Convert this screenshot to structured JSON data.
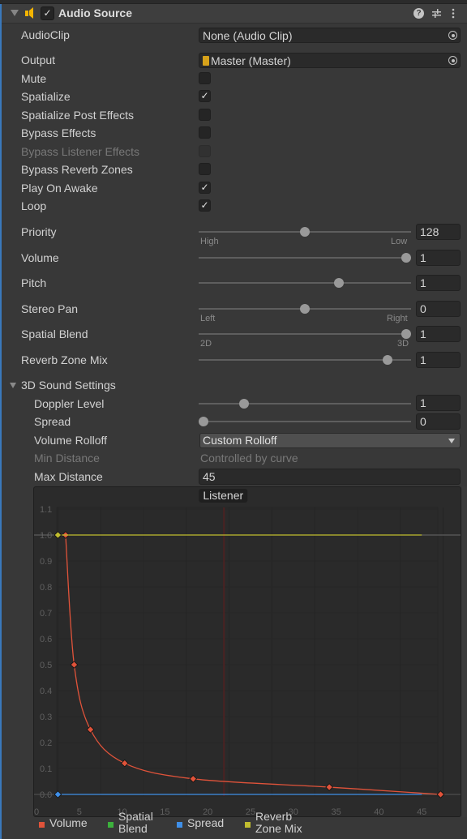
{
  "header": {
    "title": "Audio Source",
    "enabled": true,
    "icons": [
      "foldout-arrow-icon",
      "audio-source-speaker-icon",
      "help-icon",
      "presets-sliders-icon",
      "more-vertical-icon"
    ]
  },
  "fields": {
    "audio_clip": {
      "label": "AudioClip",
      "value": "None (Audio Clip)"
    },
    "output": {
      "label": "Output",
      "value": "Master (Master)"
    },
    "mute": {
      "label": "Mute",
      "checked": false
    },
    "spatialize": {
      "label": "Spatialize",
      "checked": true
    },
    "spatialize_post_effects": {
      "label": "Spatialize Post Effects",
      "checked": false
    },
    "bypass_effects": {
      "label": "Bypass Effects",
      "checked": false
    },
    "bypass_listener_effects": {
      "label": "Bypass Listener Effects",
      "checked": false,
      "disabled": true
    },
    "bypass_reverb_zones": {
      "label": "Bypass Reverb Zones",
      "checked": false
    },
    "play_on_awake": {
      "label": "Play On Awake",
      "checked": true
    },
    "loop": {
      "label": "Loop",
      "checked": true
    },
    "priority": {
      "label": "Priority",
      "value": "128",
      "min": 0,
      "max": 256,
      "fraction": 0.5,
      "min_label": "High",
      "max_label": "Low"
    },
    "volume": {
      "label": "Volume",
      "value": "1",
      "fraction": 1.0
    },
    "pitch": {
      "label": "Pitch",
      "value": "1",
      "fraction": 0.667
    },
    "stereo_pan": {
      "label": "Stereo Pan",
      "value": "0",
      "fraction": 0.5,
      "min_label": "Left",
      "max_label": "Right"
    },
    "spatial_blend": {
      "label": "Spatial Blend",
      "value": "1",
      "fraction": 1.0,
      "min_label": "2D",
      "max_label": "3D"
    },
    "reverb_zone_mix": {
      "label": "Reverb Zone Mix",
      "value": "1",
      "fraction": 0.909
    }
  },
  "sound3d": {
    "label": "3D Sound Settings",
    "doppler_level": {
      "label": "Doppler Level",
      "value": "1",
      "fraction": 0.2
    },
    "spread": {
      "label": "Spread",
      "value": "0",
      "fraction": 0.0
    },
    "volume_rolloff": {
      "label": "Volume Rolloff",
      "value": "Custom Rolloff"
    },
    "min_distance": {
      "label": "Min Distance",
      "value": "Controlled by curve",
      "disabled": true
    },
    "max_distance": {
      "label": "Max Distance",
      "value": "45"
    }
  },
  "chart_data": {
    "type": "line",
    "title": "",
    "annotation": "Listener",
    "listener_x": 21.9,
    "xlim": [
      0,
      48
    ],
    "ylim": [
      -0.05,
      1.12
    ],
    "x_ticks": [
      0,
      5,
      10,
      15,
      20,
      25,
      30,
      35,
      40,
      45
    ],
    "y_ticks": [
      0.0,
      0.1,
      0.2,
      0.3,
      0.4,
      0.5,
      0.6,
      0.7,
      0.8,
      0.9,
      1.0,
      1.1
    ],
    "y_tick_labels": [
      "0.0",
      "0.1",
      "0.2",
      "0.3",
      "0.4",
      "0.5",
      "0.6",
      "0.7",
      "0.8",
      "0.9",
      "1.0",
      "1.1"
    ],
    "grid": true,
    "legend_position": "bottom",
    "series": [
      {
        "name": "Volume",
        "color": "#e0533a",
        "keys": [
          [
            3.4,
            1.0
          ],
          [
            4.4,
            0.5
          ],
          [
            6.3,
            0.25
          ],
          [
            10.3,
            0.12
          ],
          [
            18.3,
            0.06
          ],
          [
            34.2,
            0.028
          ],
          [
            47.2,
            0.0
          ]
        ]
      },
      {
        "name": "Spatial Blend",
        "color": "#3cb13c",
        "keys": []
      },
      {
        "name": "Spread",
        "color": "#3f8fe8",
        "keys": [
          [
            2.5,
            0.0
          ],
          [
            45,
            0.0
          ]
        ]
      },
      {
        "name": "Reverb Zone Mix",
        "color": "#c1bd2f",
        "keys": [
          [
            2.5,
            1.0
          ],
          [
            45,
            1.0
          ]
        ]
      }
    ]
  },
  "legend": [
    {
      "label": "Volume",
      "color": "#e0533a"
    },
    {
      "label": "Spatial\nBlend",
      "color": "#3cb13c"
    },
    {
      "label": "Spread",
      "color": "#3f8fe8"
    },
    {
      "label": "Reverb\nZone Mix",
      "color": "#c1bd2f"
    }
  ]
}
